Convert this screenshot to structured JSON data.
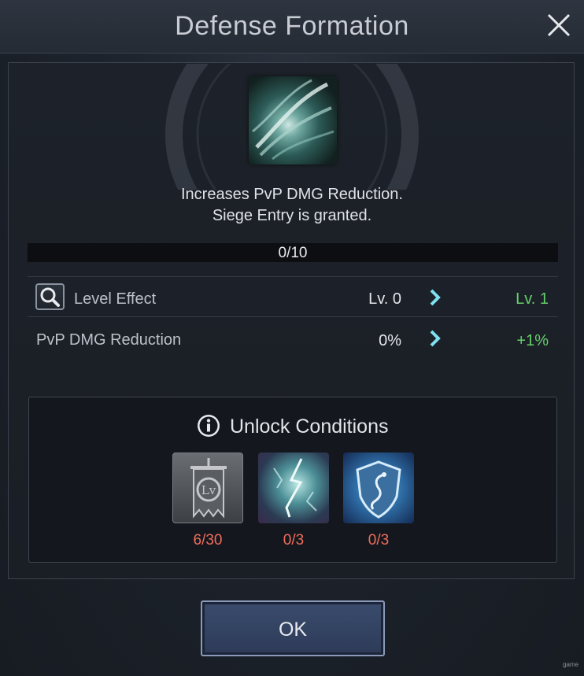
{
  "header": {
    "title": "Defense Formation"
  },
  "skill": {
    "icon": "wind-slash-skill-icon",
    "description_line1": "Increases PvP DMG Reduction.",
    "description_line2": "Siege Entry is granted."
  },
  "progress": {
    "text": "0/10",
    "fraction": 0.0
  },
  "level_effect": {
    "label": "Level Effect",
    "current": "Lv. 0",
    "next": "Lv. 1"
  },
  "stats": [
    {
      "label": "PvP DMG Reduction",
      "current": "0%",
      "next": "+1%"
    }
  ],
  "unlock": {
    "title": "Unlock Conditions",
    "conditions": [
      {
        "icon": "level-banner-icon",
        "count": "6/30"
      },
      {
        "icon": "lightning-skill-icon",
        "count": "0/3"
      },
      {
        "icon": "dragon-shield-icon",
        "count": "0/3"
      }
    ]
  },
  "footer": {
    "ok_label": "OK",
    "watermark": "game"
  },
  "colors": {
    "next_value": "#66d06a",
    "count_red": "#f06c5a",
    "button_blue": "#34456a"
  }
}
